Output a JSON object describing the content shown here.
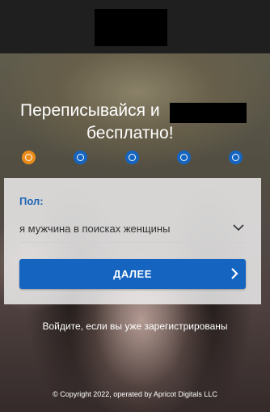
{
  "header": {
    "logo_icon": "redacted-logo"
  },
  "hero": {
    "headline_line1": "Переписывайся и",
    "headline_line2": "бесплатно!"
  },
  "steps": {
    "total": 5,
    "active_index": 0,
    "active_color": "#e98c1a",
    "inactive_color": "#1565c0"
  },
  "form": {
    "gender_label": "Пол:",
    "gender_value": "я мужчина в поисках женщины",
    "next_button": "ДАЛЕЕ"
  },
  "login_link": "Войдите, если вы уже зарегистрированы",
  "copyright": "© Copyright 2022, operated by Apricot Digitals LLC",
  "colors": {
    "accent": "#1565c0",
    "label": "#1e64b4",
    "active_step": "#e98c1a"
  }
}
